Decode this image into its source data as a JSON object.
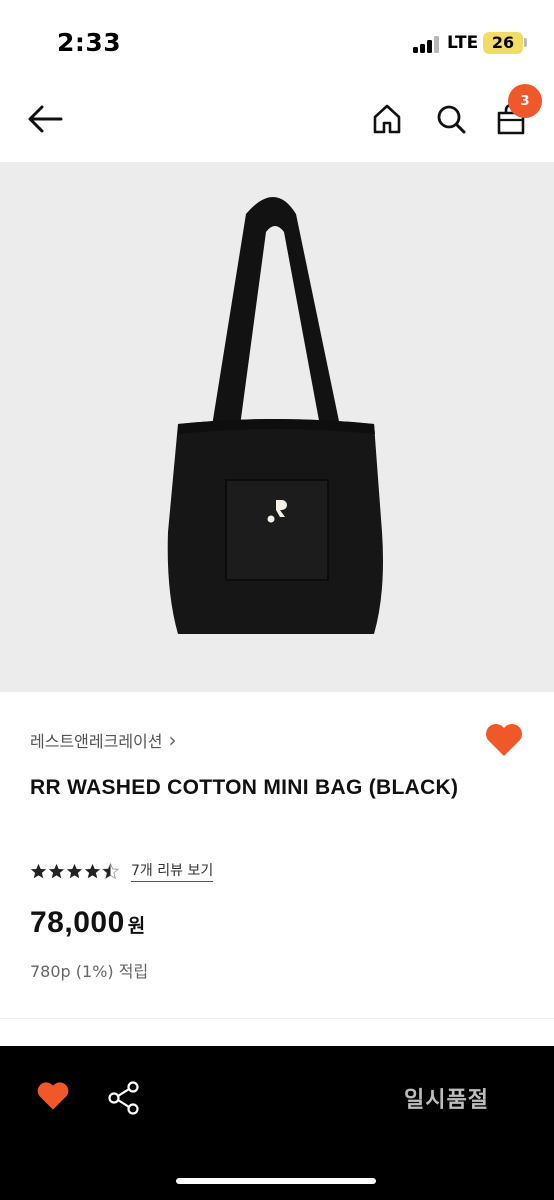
{
  "status_bar": {
    "time": "2:33",
    "network": "LTE",
    "battery": "26"
  },
  "nav": {
    "back_icon": "arrow-left-icon",
    "home_icon": "home-icon",
    "search_icon": "search-icon",
    "bag_icon": "shopping-bag-icon",
    "cart_count": "3"
  },
  "product": {
    "image_alt_icon": "tote-bag-product-image",
    "brand": "레스트앤레크레이션",
    "brand_chevron": "›",
    "name": "RR WASHED COTTON MINI BAG (BLACK)",
    "rating": 4.5,
    "rating_max": 5,
    "review_link": "7개 리뷰 보기",
    "price": "78,000",
    "currency": "원",
    "points": "780p (1%) 적립"
  },
  "bottom_bar": {
    "wishlist_icon": "heart-icon",
    "share_icon": "share-icon",
    "status_label": "일시품절"
  },
  "colors": {
    "accent": "#f0582a",
    "image_bg": "#ececec",
    "bottom_bar_bg": "#000000",
    "sold_out_text": "#bdbdbd"
  }
}
